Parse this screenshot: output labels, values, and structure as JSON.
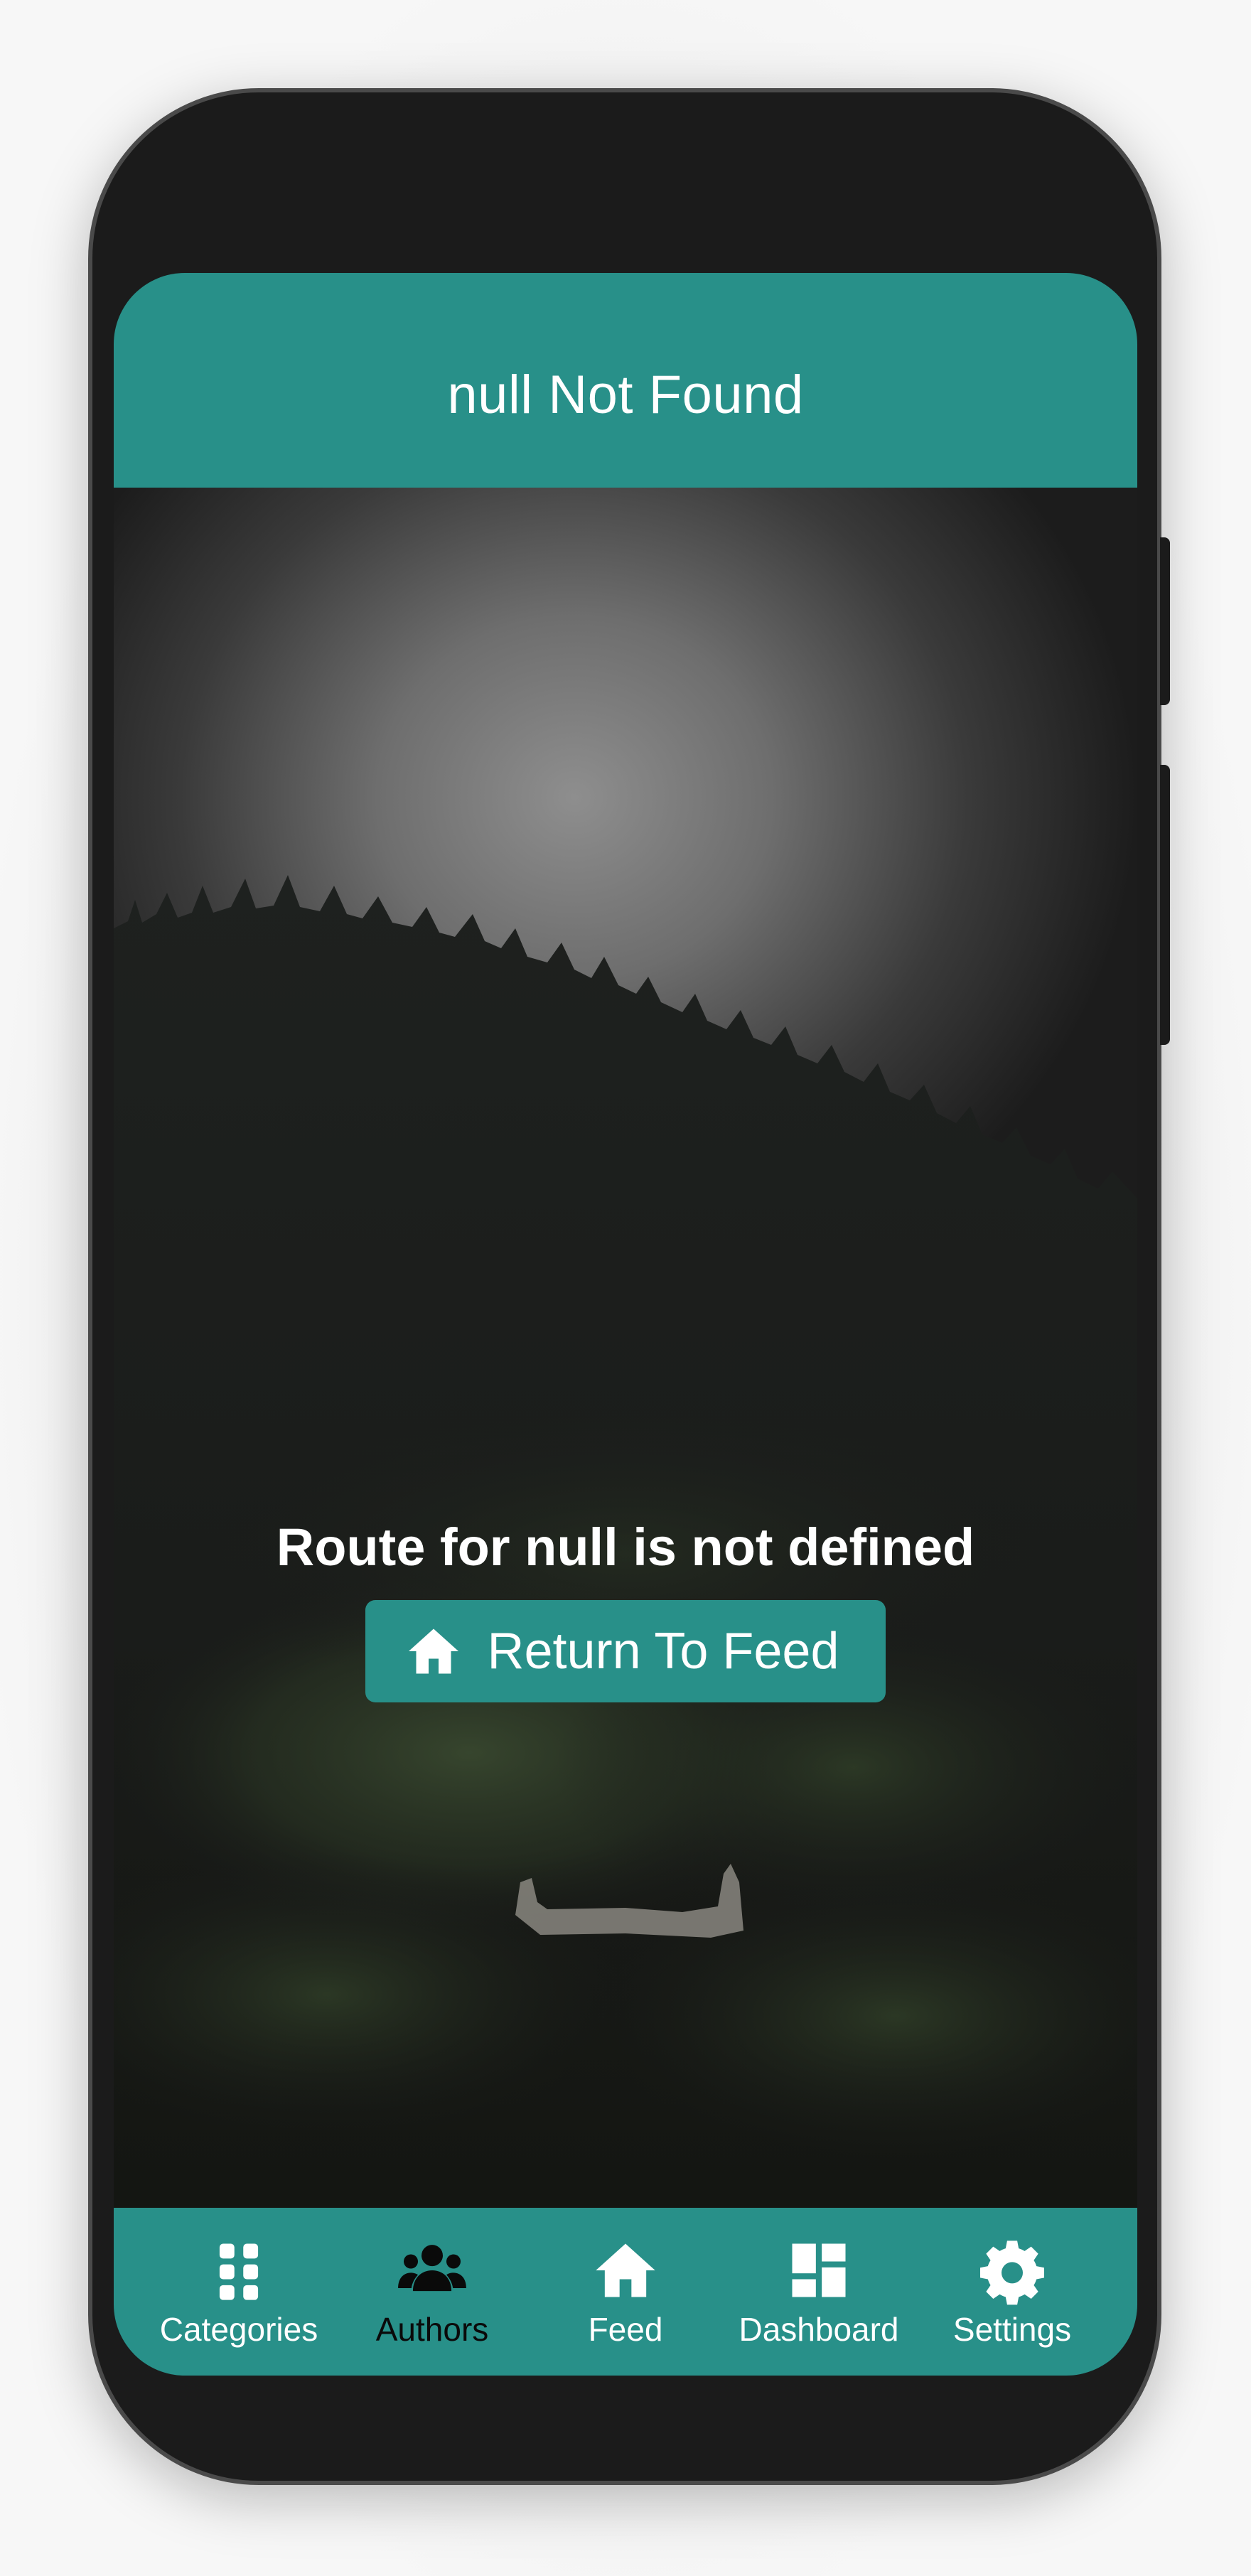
{
  "header": {
    "title": "null Not Found"
  },
  "main": {
    "message": "Route for null is not defined",
    "return_button": {
      "label": "Return To Feed",
      "icon": "home-icon"
    }
  },
  "bottom_nav": {
    "items": [
      {
        "label": "Categories",
        "icon": "grid-icon",
        "active": false
      },
      {
        "label": "Authors",
        "icon": "users-icon",
        "active": true
      },
      {
        "label": "Feed",
        "icon": "home-icon",
        "active": false
      },
      {
        "label": "Dashboard",
        "icon": "dashboard-icon",
        "active": false
      },
      {
        "label": "Settings",
        "icon": "gear-icon",
        "active": false
      }
    ]
  },
  "colors": {
    "accent": "#289089",
    "device_body": "#1b1b1b",
    "text_light": "#ffffff",
    "active_nav": "#0a0a0a"
  }
}
